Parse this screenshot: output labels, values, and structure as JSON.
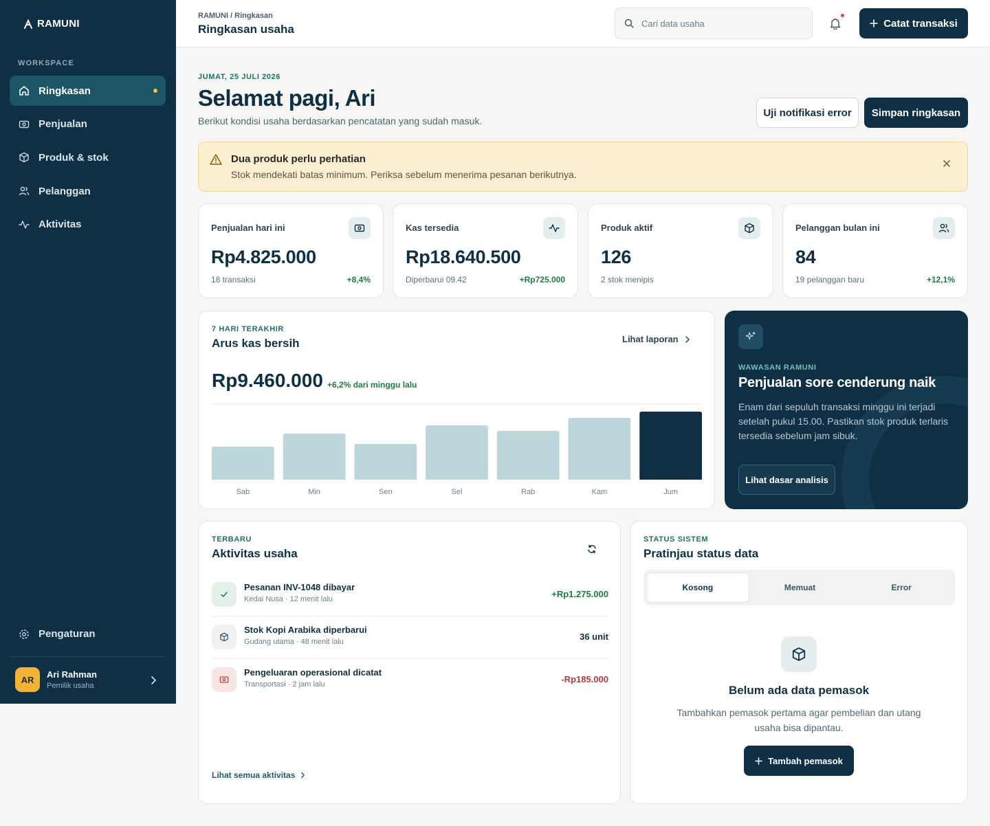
{
  "brand": {
    "name": "RAMUNI"
  },
  "sidebar": {
    "section_label": "WORKSPACE",
    "items": [
      {
        "label": "Ringkasan",
        "icon": "home-icon",
        "active": true
      },
      {
        "label": "Penjualan",
        "icon": "cash-icon"
      },
      {
        "label": "Produk & stok",
        "icon": "box-icon"
      },
      {
        "label": "Pelanggan",
        "icon": "users-icon"
      },
      {
        "label": "Aktivitas",
        "icon": "activity-icon"
      }
    ],
    "settings_label": "Pengaturan",
    "user": {
      "initials": "AR",
      "name": "Ari Rahman",
      "role": "Pemilik usaha"
    }
  },
  "topbar": {
    "breadcrumb": "RAMUNI / Ringkasan",
    "title": "Ringkasan usaha",
    "search_placeholder": "Cari data usaha",
    "new_button": "Catat transaksi"
  },
  "hero": {
    "date": "JUMAT, 25 JULI 2026",
    "greeting": "Selamat pagi, Ari",
    "subtitle": "Berikut kondisi usaha berdasarkan pencatatan yang sudah masuk.",
    "test_button": "Uji notifikasi error",
    "save_button": "Simpan ringkasan"
  },
  "alert": {
    "title": "Dua produk perlu perhatian",
    "text": "Stok mendekati batas minimum. Periksa sebelum menerima pesanan berikutnya."
  },
  "stats": [
    {
      "label": "Penjualan hari ini",
      "icon": "cash-icon",
      "value": "Rp4.825.000",
      "foot": "18 transaksi",
      "delta": "+8,4%"
    },
    {
      "label": "Kas tersedia",
      "icon": "activity-icon",
      "value": "Rp18.640.500",
      "foot": "Diperbarui 09.42",
      "delta": "+Rp725.000"
    },
    {
      "label": "Produk aktif",
      "icon": "box-icon",
      "value": "126",
      "foot": "2 stok menipis",
      "delta": ""
    },
    {
      "label": "Pelanggan bulan ini",
      "icon": "users-icon",
      "value": "84",
      "foot": "19 pelanggan baru",
      "delta": "+12,1%"
    }
  ],
  "cashflow": {
    "eyebrow": "7 HARI TERAKHIR",
    "title": "Arus kas bersih",
    "link": "Lihat laporan",
    "total": "Rp9.460.000",
    "delta": "+6,2% dari minggu lalu"
  },
  "chart_data": {
    "type": "bar",
    "categories": [
      "Sab",
      "Min",
      "Sen",
      "Sel",
      "Rab",
      "Kam",
      "Jum"
    ],
    "values": [
      48,
      67,
      52,
      79,
      71,
      90,
      99
    ],
    "ylim": [
      0,
      110
    ],
    "highlight_index": 6,
    "colors": {
      "bar": "#bcd6dc",
      "highlight": "#0f2f44"
    },
    "grid": false
  },
  "insight": {
    "eyebrow": "WAWASAN RAMUNI",
    "title": "Penjualan sore cenderung naik",
    "text": "Enam dari sepuluh transaksi minggu ini terjadi setelah pukul 15.00. Pastikan stok produk terlaris tersedia sebelum jam sibuk.",
    "button": "Lihat dasar analisis"
  },
  "activity": {
    "eyebrow": "TERBARU",
    "title": "Aktivitas usaha",
    "items": [
      {
        "title": "Pesanan INV-1048 dibayar",
        "meta": "Kedai Nusa · 12 menit lalu",
        "amount": "+Rp1.275.000",
        "tone": "positive",
        "icon": "check-icon"
      },
      {
        "title": "Stok Kopi Arabika diperbarui",
        "meta": "Gudang utama · 48 menit lalu",
        "amount": "36 unit",
        "tone": "neutral",
        "icon": "box-icon"
      },
      {
        "title": "Pengeluaran operasional dicatat",
        "meta": "Transportasi · 2 jam lalu",
        "amount": "-Rp185.000",
        "tone": "negative",
        "icon": "cash-icon"
      }
    ],
    "all_link": "Lihat semua aktivitas"
  },
  "status": {
    "eyebrow": "STATUS SISTEM",
    "title": "Pratinjau status data",
    "tabs": [
      "Kosong",
      "Memuat",
      "Error"
    ],
    "active_tab": "Kosong",
    "empty_title": "Belum ada data pemasok",
    "empty_text": "Tambahkan pemasok pertama agar pembelian dan utang usaha bisa dipantau.",
    "button": "Tambah pemasok"
  },
  "colors": {
    "primary": "#0f2f44",
    "accent": "#1f6f66",
    "positive": "#1f7a45",
    "negative": "#b23a3a",
    "warning_bg": "#fbeed1"
  }
}
